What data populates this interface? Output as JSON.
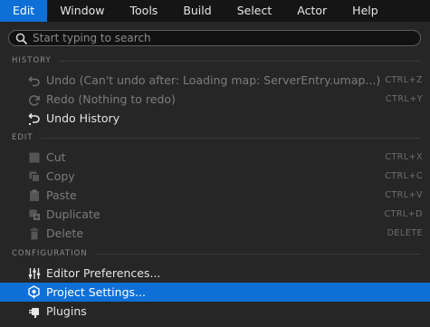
{
  "menubar": {
    "items": [
      "Edit",
      "Window",
      "Tools",
      "Build",
      "Select",
      "Actor",
      "Help"
    ]
  },
  "search": {
    "placeholder": "Start typing to search"
  },
  "sections": {
    "history": "HISTORY",
    "edit": "EDIT",
    "configuration": "CONFIGURATION"
  },
  "history": [
    {
      "label": "Undo (Can't undo after: Loading map: ServerEntry.umap...)",
      "shortcut": "CTRL+Z",
      "icon": "undo-icon",
      "enabled": false
    },
    {
      "label": "Redo (Nothing to redo)",
      "shortcut": "CTRL+Y",
      "icon": "redo-icon",
      "enabled": false
    },
    {
      "label": "Undo History",
      "shortcut": "",
      "icon": "undo-history-icon",
      "enabled": true
    }
  ],
  "edit": [
    {
      "label": "Cut",
      "shortcut": "CTRL+X",
      "icon": "cut-icon",
      "enabled": false
    },
    {
      "label": "Copy",
      "shortcut": "CTRL+C",
      "icon": "copy-icon",
      "enabled": false
    },
    {
      "label": "Paste",
      "shortcut": "CTRL+V",
      "icon": "paste-icon",
      "enabled": false
    },
    {
      "label": "Duplicate",
      "shortcut": "CTRL+D",
      "icon": "duplicate-icon",
      "enabled": false
    },
    {
      "label": "Delete",
      "shortcut": "DELETE",
      "icon": "delete-icon",
      "enabled": false
    }
  ],
  "configuration": [
    {
      "label": "Editor Preferences...",
      "shortcut": "",
      "icon": "sliders-icon",
      "enabled": true
    },
    {
      "label": "Project Settings...",
      "shortcut": "",
      "icon": "project-settings-icon",
      "enabled": true,
      "selected": true
    },
    {
      "label": "Plugins",
      "shortcut": "",
      "icon": "plug-icon",
      "enabled": true
    }
  ],
  "colors": {
    "accent": "#0e70d6",
    "menubar_bg": "#151515",
    "panel_bg": "#262626",
    "disabled_text": "#7c7c7c"
  }
}
